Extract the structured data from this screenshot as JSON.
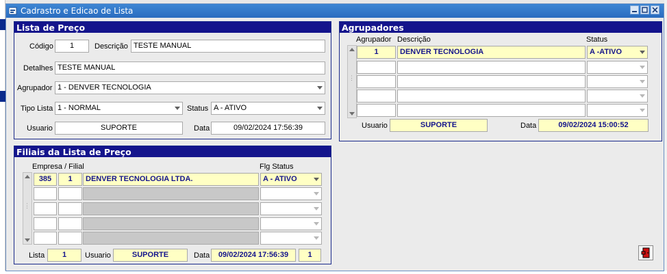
{
  "window": {
    "title": "Cadrastro e Edicao de Lista"
  },
  "lista_preco": {
    "heading": "Lista de Preço",
    "codigo_label": "Código",
    "codigo_value": "1",
    "descricao_label": "Descrição",
    "descricao_value": "TESTE MANUAL",
    "detalhes_label": "Detalhes",
    "detalhes_value": "TESTE MANUAL",
    "agrupador_label": "Agrupador",
    "agrupador_value": "1 - DENVER TECNOLOGIA",
    "tipo_lista_label": "Tipo Lista",
    "tipo_lista_value": "1 - NORMAL",
    "status_label": "Status",
    "status_value": "A - ATIVO",
    "usuario_label": "Usuario",
    "usuario_value": "SUPORTE",
    "data_label": "Data",
    "data_value": "09/02/2024 17:56:39"
  },
  "agrupadores": {
    "heading": "Agrupadores",
    "col_agrupador": "Agrupador",
    "col_descricao": "Descrição",
    "col_status": "Status",
    "rows": [
      {
        "agrupador": "1",
        "descricao": "DENVER TECNOLOGIA",
        "status": "A -ATIVO"
      }
    ],
    "usuario_label": "Usuario",
    "usuario_value": "SUPORTE",
    "data_label": "Data",
    "data_value": "09/02/2024 15:00:52"
  },
  "filiais": {
    "heading": "Filiais da Lista de Preço",
    "col_empresa_filial": "Empresa / Filial",
    "col_flg_status": "Flg Status",
    "rows": [
      {
        "empresa": "385",
        "filial": "1",
        "nome": "DENVER TECNOLOGIA LTDA.",
        "status": "A - ATIVO"
      }
    ],
    "lista_label": "Lista",
    "lista_value": "1",
    "usuario_label": "Usuario",
    "usuario_value": "SUPORTE",
    "data_label": "Data",
    "data_value": "09/02/2024 17:56:39",
    "count_value": "1"
  },
  "icons": {
    "app": "form-icon",
    "minimize": "minimize-icon",
    "maximize": "maximize-icon",
    "close": "close-icon",
    "exit": "exit-door-icon"
  },
  "colors": {
    "panel_header": "#14148c",
    "titlebar": "#2a6cbf",
    "highlight_field": "#ffffc4",
    "disabled_cell": "#c8c8c8"
  }
}
